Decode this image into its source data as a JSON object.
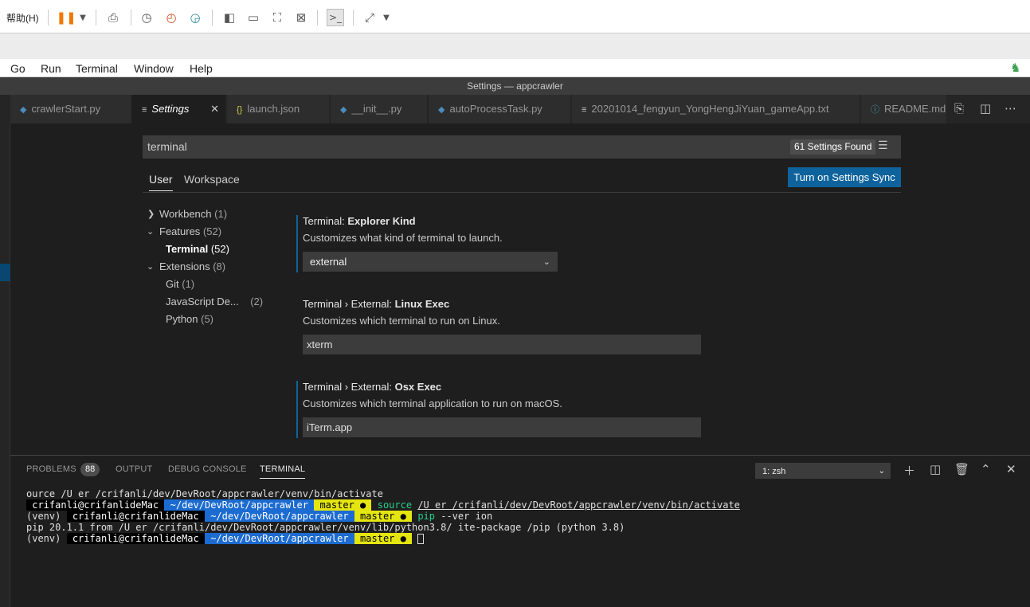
{
  "vm_toolbar": {
    "help_label": "帮助(H)",
    "icons": [
      "pause-icon",
      "dropdown-icon",
      "send-keys-icon",
      "snapshot-icon",
      "revert-snapshot-icon",
      "manage-snapshots-icon",
      "single-window-icon",
      "console-view-icon",
      "fullscreen-icon",
      "unity-icon",
      "terminal-icon",
      "stretch-icon",
      "stretch-dropdown-icon"
    ]
  },
  "menu": [
    "Go",
    "Run",
    "Terminal",
    "Window",
    "Help"
  ],
  "window_title": "Settings — appcrawler",
  "tabs": [
    {
      "label": "crawlerStart.py",
      "icon": "python-icon"
    },
    {
      "label": "Settings",
      "icon": "settings-icon",
      "active": true
    },
    {
      "label": "launch.json",
      "icon": "json-icon"
    },
    {
      "label": "__init__.py",
      "icon": "python-icon"
    },
    {
      "label": "autoProcessTask.py",
      "icon": "python-icon"
    },
    {
      "label": "20201014_fengyun_YongHengJiYuan_gameApp.txt",
      "icon": "text-file-icon"
    },
    {
      "label": "README.md",
      "icon": "info-icon"
    }
  ],
  "settings": {
    "search_value": "terminal",
    "found_label": "61 Settings Found",
    "scopes": [
      "User",
      "Workspace"
    ],
    "sync_button": "Turn on Settings Sync",
    "tree": [
      {
        "label": "Workbench",
        "count": "(1)"
      },
      {
        "label": "Features",
        "count": "(52)"
      },
      {
        "label": "Terminal",
        "count": "(52)"
      },
      {
        "label": "Extensions",
        "count": "(8)"
      },
      {
        "label": "Git",
        "count": "(1)"
      },
      {
        "label": "JavaScript De...",
        "count": "(2)"
      },
      {
        "label": "Python",
        "count": "(5)"
      }
    ],
    "items": [
      {
        "category": "Terminal: ",
        "name": "Explorer Kind",
        "description": "Customizes what kind of terminal to launch.",
        "value": "external"
      },
      {
        "category": "Terminal › External: ",
        "name": "Linux Exec",
        "description": "Customizes which terminal to run on Linux.",
        "value": "xterm"
      },
      {
        "category": "Terminal › External: ",
        "name": "Osx Exec",
        "description": "Customizes which terminal application to run on macOS.",
        "value": "iTerm.app"
      }
    ]
  },
  "panel": {
    "tabs": [
      "PROBLEMS",
      "OUTPUT",
      "DEBUG CONSOLE",
      "TERMINAL"
    ],
    "problems_count": "88",
    "shell": "1: zsh",
    "terminal": {
      "line1": "ource /U er /crifanli/dev/DevRoot/appcrawler/venv/bin/activate",
      "user": " crifanli@crifanlideMac ",
      "path_a": " ~/dev/DevRoot/appcrawler ",
      "branch": " master ● ",
      "line2_cmd": "source",
      "line2_arg": "/U er /crifanli/dev/DevRoot/appcrawler/venv/bin/activate",
      "venv": "(venv)",
      "line3_cmd": "pip",
      "line3_arg": "--ver ion",
      "line4": "pip 20.1.1 from /U er /crifanli/dev/DevRoot/appcrawler/venv/lib/python3.8/ ite-package /pip (python 3.8)"
    }
  }
}
